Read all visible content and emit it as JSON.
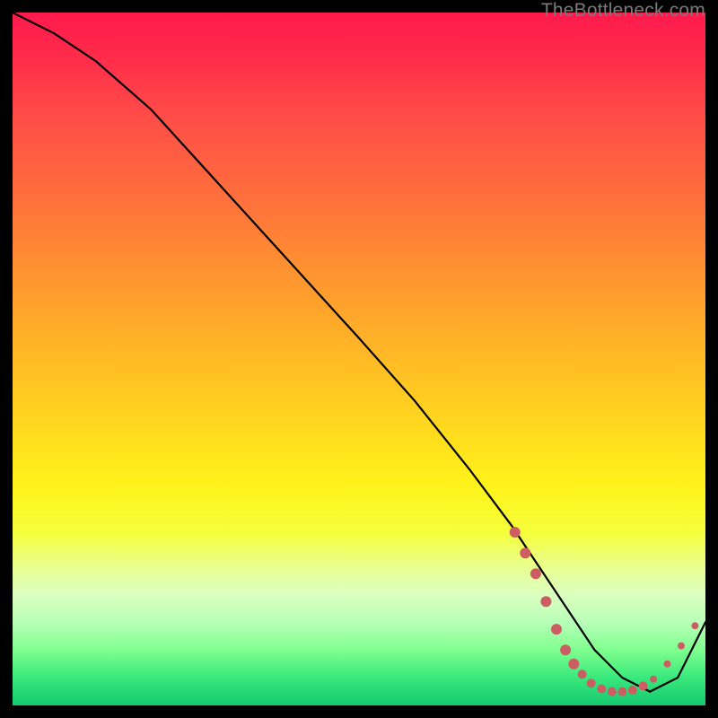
{
  "watermark": "TheBottleneck.com",
  "chart_data": {
    "type": "line",
    "title": "",
    "xlabel": "",
    "ylabel": "",
    "xlim": [
      0,
      100
    ],
    "ylim": [
      0,
      100
    ],
    "series": [
      {
        "name": "curve",
        "x": [
          0,
          6,
          12,
          20,
          30,
          40,
          50,
          58,
          66,
          72,
          76,
          80,
          84,
          88,
          92,
          96,
          100
        ],
        "y": [
          100,
          97,
          93,
          86,
          75,
          64,
          53,
          44,
          34,
          26,
          20,
          14,
          8,
          4,
          2,
          4,
          12
        ]
      }
    ],
    "markers": {
      "name": "highlight-dots",
      "color": "#cc5d62",
      "points": [
        {
          "x": 72.5,
          "y": 25,
          "r": 6
        },
        {
          "x": 74.0,
          "y": 22,
          "r": 6
        },
        {
          "x": 75.5,
          "y": 19,
          "r": 6
        },
        {
          "x": 77.0,
          "y": 15,
          "r": 6
        },
        {
          "x": 78.5,
          "y": 11,
          "r": 6
        },
        {
          "x": 79.8,
          "y": 8,
          "r": 6
        },
        {
          "x": 81.0,
          "y": 6,
          "r": 6
        },
        {
          "x": 82.2,
          "y": 4.5,
          "r": 5
        },
        {
          "x": 83.5,
          "y": 3.2,
          "r": 5
        },
        {
          "x": 85.0,
          "y": 2.4,
          "r": 5
        },
        {
          "x": 86.5,
          "y": 2.0,
          "r": 5
        },
        {
          "x": 88.0,
          "y": 2.0,
          "r": 5
        },
        {
          "x": 89.5,
          "y": 2.2,
          "r": 5
        },
        {
          "x": 91.0,
          "y": 2.8,
          "r": 5
        },
        {
          "x": 92.5,
          "y": 3.8,
          "r": 4
        },
        {
          "x": 94.5,
          "y": 6.0,
          "r": 4
        },
        {
          "x": 96.5,
          "y": 8.6,
          "r": 4
        },
        {
          "x": 98.5,
          "y": 11.5,
          "r": 4
        }
      ]
    },
    "background": {
      "type": "vertical-gradient",
      "stops": [
        {
          "pos": 0,
          "color": "#ff1a4d"
        },
        {
          "pos": 50,
          "color": "#ffcf20"
        },
        {
          "pos": 78,
          "color": "#f0ff60"
        },
        {
          "pos": 100,
          "color": "#14c86e"
        }
      ]
    }
  }
}
